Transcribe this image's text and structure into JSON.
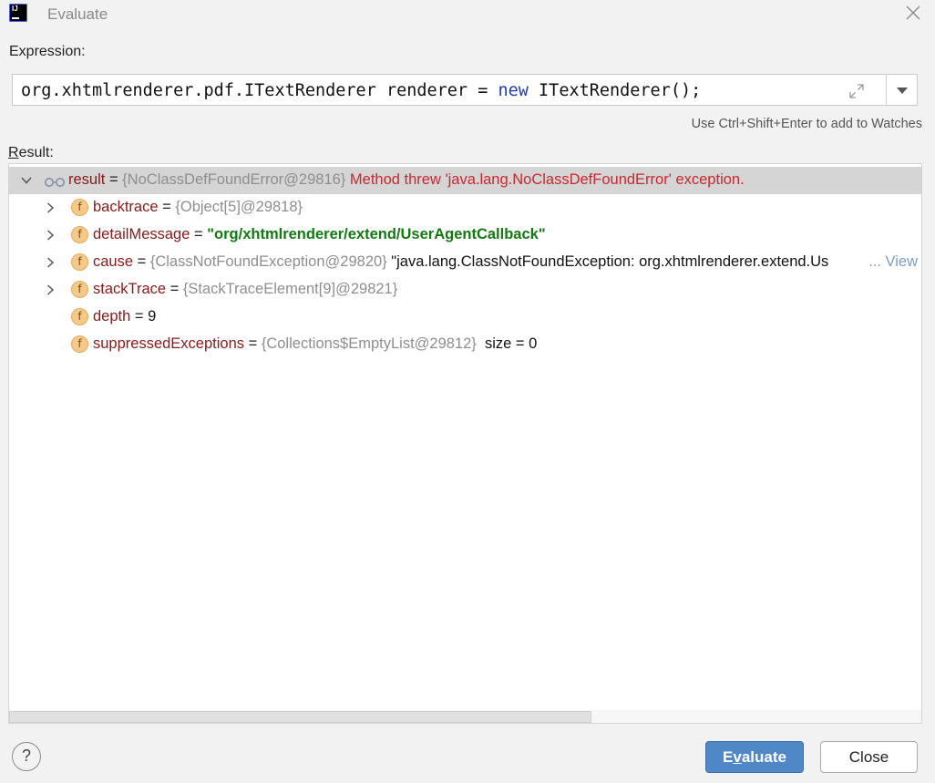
{
  "window": {
    "title": "Evaluate",
    "app_icon_text": "IJ"
  },
  "expression": {
    "label": "Expression:",
    "code_prefix": "org.xhtmlrenderer.pdf.ITextRenderer renderer = ",
    "code_keyword": "new",
    "code_suffix": " ITextRenderer();",
    "hint": "Use Ctrl+Shift+Enter to add to Watches"
  },
  "result": {
    "label_mnemonic": "R",
    "label_rest": "esult:",
    "root": {
      "name": "result",
      "eq": " = ",
      "type": "{NoClassDefFoundError@29816}",
      "message": "Method threw 'java.lang.NoClassDefFoundError' exception."
    },
    "children": [
      {
        "name": "backtrace",
        "eq": " = ",
        "type": "{Object[5]@29818}",
        "value": ""
      },
      {
        "name": "detailMessage",
        "eq": " = ",
        "type": "",
        "value": "\"org/xhtmlrenderer/extend/UserAgentCallback\""
      },
      {
        "name": "cause",
        "eq": " = ",
        "type": "{ClassNotFoundException@29820}",
        "value": "\"java.lang.ClassNotFoundException: org.xhtmlrenderer.extend.Us"
      },
      {
        "name": "stackTrace",
        "eq": " = ",
        "type": "{StackTraceElement[9]@29821}",
        "value": ""
      },
      {
        "name": "depth",
        "eq": " = ",
        "type": "",
        "value": "9"
      },
      {
        "name": "suppressedExceptions",
        "eq": " = ",
        "type": "{Collections$EmptyList@29812}",
        "value": "size = 0"
      }
    ],
    "view_link": "... View",
    "field_icon_letter": "f"
  },
  "buttons": {
    "help": "?",
    "evaluate_pre": "E",
    "evaluate_mnemonic": "v",
    "evaluate_post": "aluate",
    "close": "Close"
  },
  "colors": {
    "accent": "#4f87c7",
    "field_name": "#871a1a",
    "error": "#c7292f",
    "string": "#137a13",
    "keyword": "#1f3cb8"
  }
}
